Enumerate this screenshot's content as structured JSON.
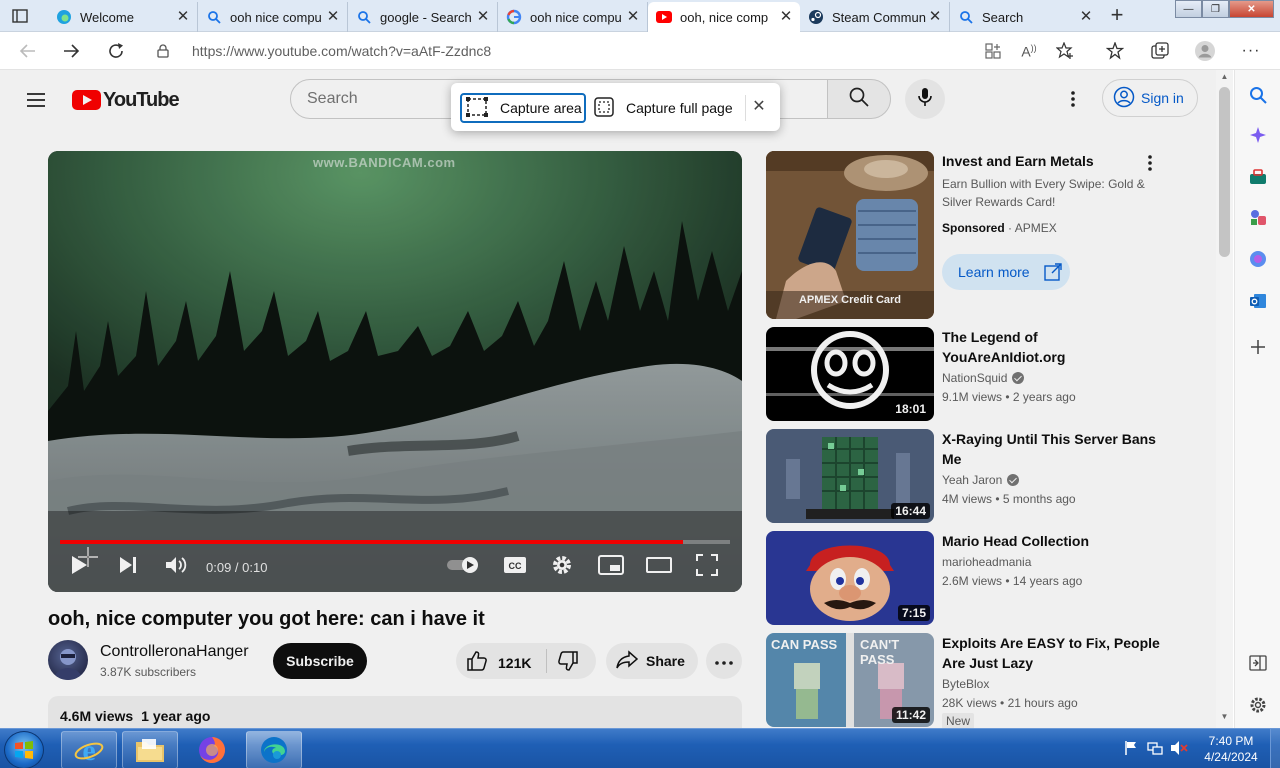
{
  "browser": {
    "tabs": [
      {
        "title": "Welcome",
        "icon": "edge-icon",
        "active": false
      },
      {
        "title": "ooh nice compu",
        "icon": "search-icon",
        "active": false
      },
      {
        "title": "google - Search",
        "icon": "search-icon",
        "active": false
      },
      {
        "title": "ooh nice compu",
        "icon": "google-icon",
        "active": false
      },
      {
        "title": "ooh, nice comp",
        "icon": "youtube-icon",
        "active": true
      },
      {
        "title": "Steam Commun",
        "icon": "steam-icon",
        "active": false
      },
      {
        "title": "Search",
        "icon": "search-icon",
        "active": false
      }
    ],
    "url": "https://www.youtube.com/watch?v=aAtF-Zzdnc8"
  },
  "youtube": {
    "logo_text": "YouTube",
    "search_placeholder": "Search",
    "sign_in": "Sign in"
  },
  "capture_popup": {
    "area_label": "Capture area",
    "full_label": "Capture full page"
  },
  "player": {
    "watermark": "www.BANDICAM.com",
    "time": "0:09 / 0:10",
    "progress_fraction": 0.93
  },
  "video": {
    "title": "ooh, nice computer you got here: can i have it",
    "channel": "ControlleronaHanger",
    "subscribers": "3.87K subscribers",
    "subscribe_label": "Subscribe",
    "likes": "121K",
    "share_label": "Share",
    "views": "4.6M views",
    "age": "1 year ago"
  },
  "ad": {
    "title": "Invest and Earn Metals",
    "description": "Earn Bullion with Every Swipe: Gold & Silver Rewards Card!",
    "sponsored": "Sponsored",
    "advertiser": "APMEX",
    "cta": "Learn more",
    "thumb_caption": "APMEX Credit Card"
  },
  "recommendations": [
    {
      "title": "The Legend of YouAreAnIdiot.org",
      "channel": "NationSquid",
      "verified": true,
      "views": "9.1M views",
      "age": "2 years ago",
      "duration": "18:01"
    },
    {
      "title": "X-Raying Until This Server Bans Me",
      "channel": "Yeah Jaron",
      "verified": true,
      "views": "4M views",
      "age": "5 months ago",
      "duration": "16:44"
    },
    {
      "title": "Mario Head Collection",
      "channel": "marioheadmania",
      "verified": false,
      "views": "2.6M views",
      "age": "14 years ago",
      "duration": "7:15"
    },
    {
      "title": "Exploits Are EASY to Fix, People Are Just Lazy",
      "channel": "ByteBlox",
      "verified": false,
      "views": "28K views",
      "age": "21 hours ago",
      "duration": "11:42",
      "badge": "New",
      "thumb_left": "CAN PASS",
      "thumb_right": "CAN'T PASS"
    }
  ],
  "taskbar": {
    "time": "7:40 PM",
    "date": "4/24/2024"
  }
}
